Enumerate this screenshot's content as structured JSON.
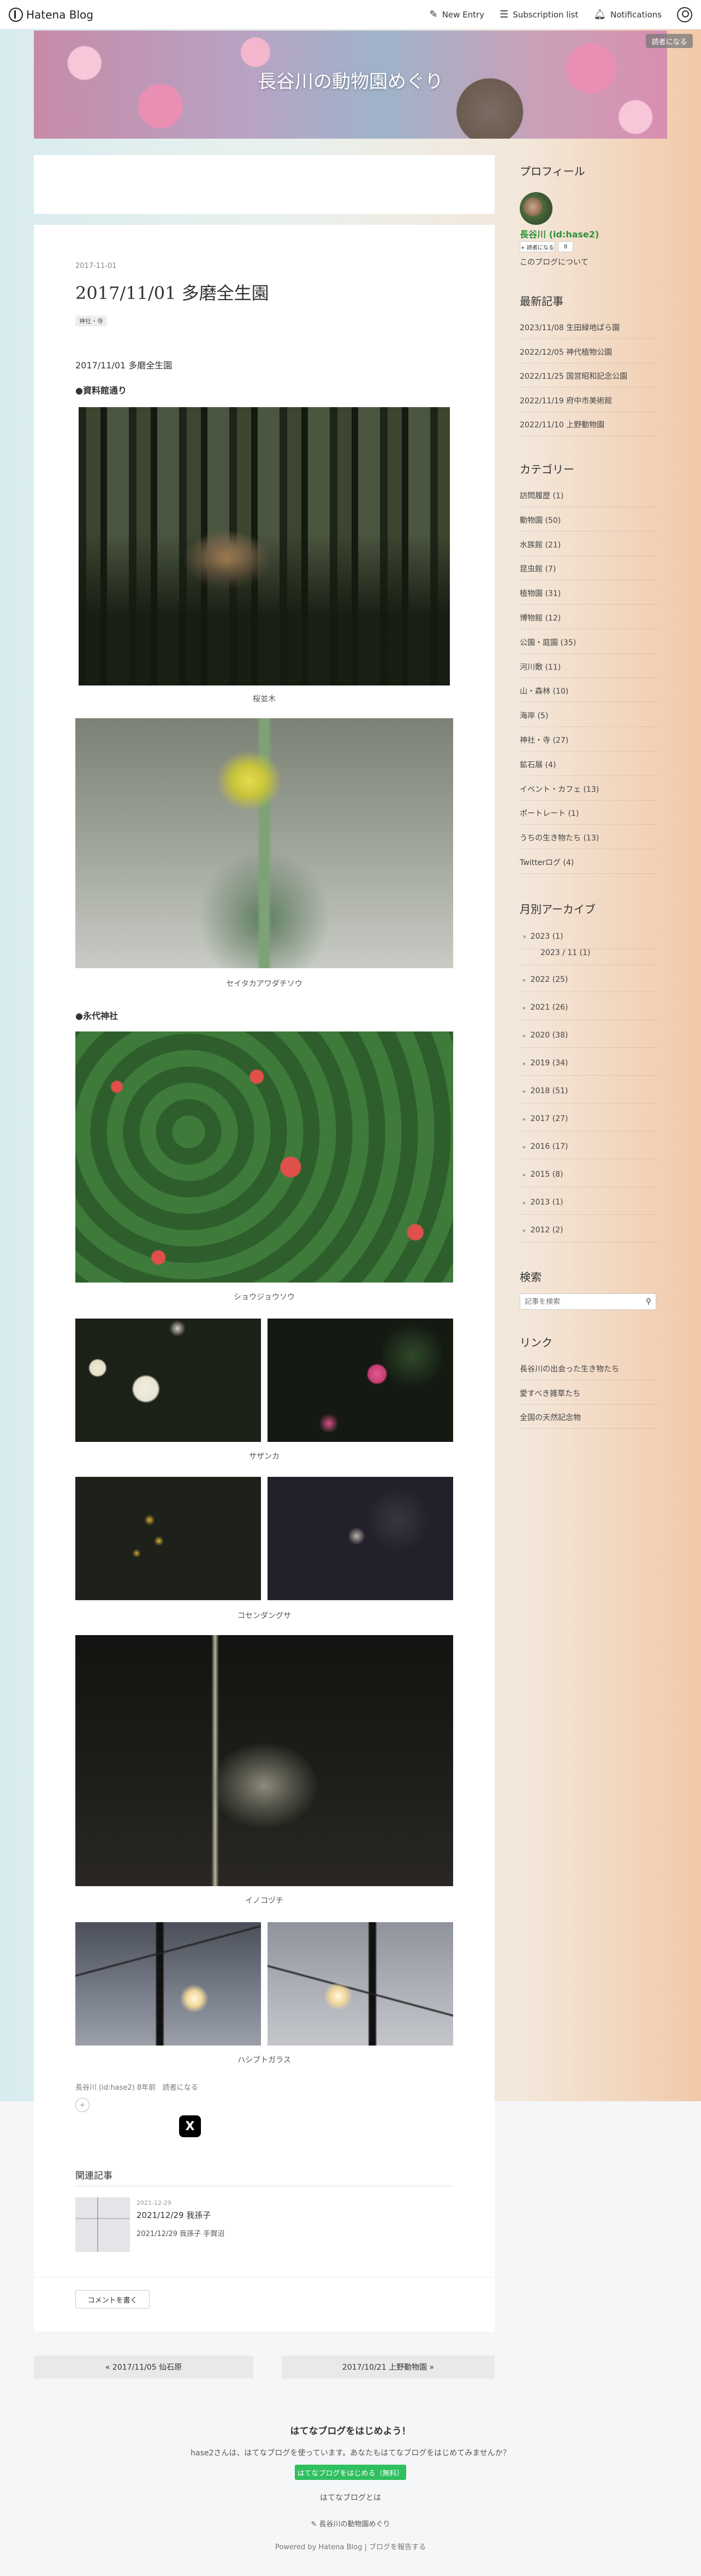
{
  "header": {
    "logo_text": "Hatena Blog",
    "new_entry": "New Entry",
    "subscription_list": "Subscription list",
    "notifications": "Notifications"
  },
  "blog": {
    "title": "長谷川の動物園めぐり",
    "reader_button": "読者になる"
  },
  "article": {
    "date": "2017-11-01",
    "title": "2017/11/01 多磨全生園",
    "category": "神社・寺",
    "lead": "2017/11/01 多磨全生園",
    "section1": "●資料館通り",
    "section2": "●永代神社",
    "captions": {
      "c1": "桜並木",
      "c2": "セイタカアワダチソウ",
      "c3": "ショウジョウソウ",
      "c4": "サザンカ",
      "c5": "コセンダングサ",
      "c6": "イノコヅチ",
      "c7": "ハシブトガラス"
    },
    "meta": "長谷川 (id:hase2) 8年前",
    "meta_reader": "読者になる",
    "star_icon": "+",
    "share_x": "X",
    "related_heading": "関連記事",
    "related": {
      "date": "2021-12-29",
      "title": "2021/12/29 我孫子",
      "sub": "2021/12/29 我孫子 手賀沼"
    },
    "comment_button": "コメントを書く"
  },
  "pager": {
    "prev": "« 2017/11/05 仙石原",
    "next": "2017/10/21 上野動物園 »"
  },
  "sidebar": {
    "profile_title": "プロフィール",
    "profile_name": "長谷川 (id:hase2)",
    "profile_reader_btn": "+ 読者になる",
    "profile_reader_count": "8",
    "profile_about": "このブログについて",
    "recent_title": "最新記事",
    "recent": [
      "2023/11/08 生田緑地ばら園",
      "2022/12/05 神代植物公園",
      "2022/11/25 国営昭和記念公園",
      "2022/11/19 府中市美術館",
      "2022/11/10 上野動物園"
    ],
    "category_title": "カテゴリー",
    "categories": [
      "訪問履歴 (1)",
      "動物園 (50)",
      "水族館 (21)",
      "昆虫館 (7)",
      "植物園 (31)",
      "博物館 (12)",
      "公園・庭園 (35)",
      "河川敷 (11)",
      "山・森林 (10)",
      "海岸 (5)",
      "神社・寺 (27)",
      "鉱石展 (4)",
      "イベント・カフェ (13)",
      "ポートレート (1)",
      "うちの生き物たち (13)",
      "Twitterログ (4)"
    ],
    "archive_title": "月別アーカイブ",
    "archive": [
      {
        "label": "2023 (1)",
        "open": true
      },
      {
        "label": "2023 / 11 (1)",
        "sub": true
      },
      {
        "label": "2022 (25)"
      },
      {
        "label": "2021 (26)"
      },
      {
        "label": "2020 (38)"
      },
      {
        "label": "2019 (34)"
      },
      {
        "label": "2018 (51)"
      },
      {
        "label": "2017 (27)"
      },
      {
        "label": "2016 (17)"
      },
      {
        "label": "2015 (8)"
      },
      {
        "label": "2013 (1)"
      },
      {
        "label": "2012 (2)"
      }
    ],
    "search_title": "検索",
    "search_placeholder": "記事を検索",
    "links_title": "リンク",
    "links": [
      "長谷川の出会った生き物たち",
      "愛すべき雑草たち",
      "全国の天然記念物"
    ]
  },
  "promo": {
    "title": "はてなブログをはじめよう！",
    "text": "hase2さんは、はてなブログを使っています。あなたもはてなブログをはじめてみませんか？",
    "button": "はてなブログをはじめる（無料）",
    "about": "はてなブログとは",
    "owner": "長谷川の動物園めぐり",
    "powered": "Powered by Hatena Blog | ブログを報告する"
  }
}
